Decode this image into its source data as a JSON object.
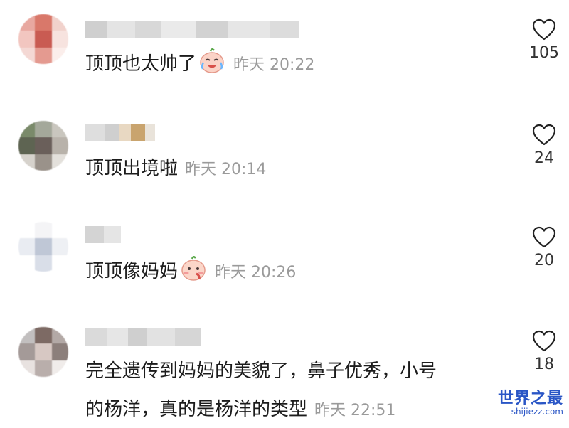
{
  "comments": [
    {
      "text": "顶顶也太帅了",
      "emoji": "crying-laughing-face-icon",
      "time": "昨天 20:22",
      "likes": "105"
    },
    {
      "text": "顶顶出境啦",
      "emoji": "",
      "time": "昨天 20:14",
      "likes": "24"
    },
    {
      "text": "顶顶像妈妈",
      "emoji": "blushing-face-icon",
      "time": "昨天 20:26",
      "likes": "20"
    },
    {
      "text_line1": "完全遗传到妈妈的美貌了，鼻子优秀，小号",
      "text_line2": "的杨洋，真的是杨洋的类型",
      "time": "昨天 22:51",
      "likes": "18"
    }
  ],
  "watermark": {
    "main": "世界之最",
    "sub": "shijiezz.com"
  },
  "colors": {
    "timestamp": "#9a9a9a",
    "text": "#1c1c1c",
    "watermark": "#2a56c6"
  }
}
